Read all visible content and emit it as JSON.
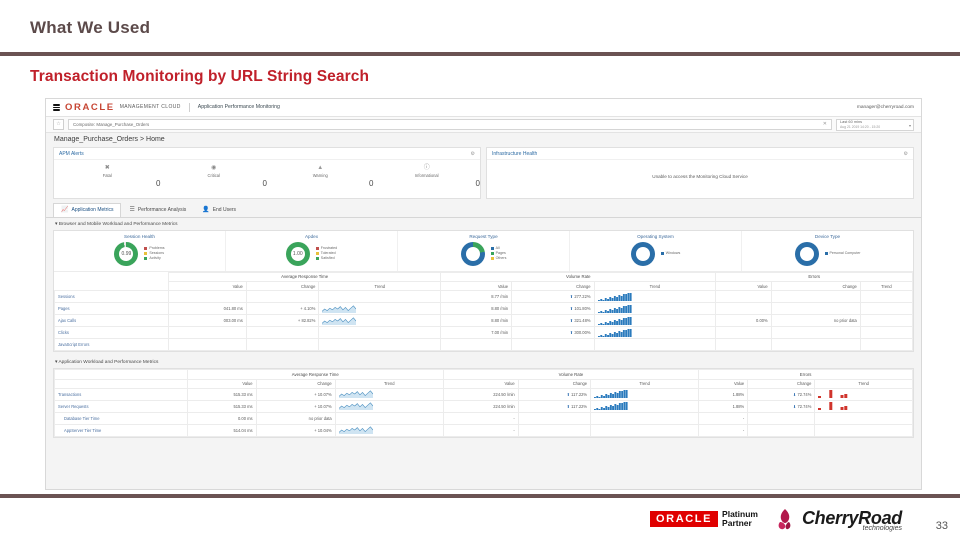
{
  "slide": {
    "title": "What We Used",
    "subtitle": "Transaction Monitoring by URL String Search",
    "page_number": "33",
    "rule_color": "#6b5353",
    "subtitle_color": "#c0202a"
  },
  "screenshot": {
    "topbar": {
      "menu_icon": "hamburger-icon",
      "brand": "ORACLE",
      "brand_suffix": "MANAGEMENT CLOUD",
      "app_name": "Application Performance Monitoring",
      "user": "manager@cherryroad.com"
    },
    "searchbar": {
      "favorite_icon": "star-icon",
      "value": "Composite: Manage_Purchase_Orders",
      "clear_icon": "close-icon",
      "time_selector": {
        "label": "Last 60 mins",
        "range": "Aug 21 2019 14:20 - 15:20",
        "chevron_icon": "chevron-down-icon"
      }
    },
    "breadcrumb": "Manage_Purchase_Orders > Home",
    "cards": [
      {
        "title": "APM Alerts",
        "gear_icon": "gear-icon",
        "alerts": [
          {
            "icon": "fatal-icon",
            "color": "#8a8a8a",
            "label": "Fatal",
            "count": "0"
          },
          {
            "icon": "critical-icon",
            "color": "#8a8a8a",
            "label": "Critical",
            "count": "0"
          },
          {
            "icon": "warning-icon",
            "color": "#9a9a9a",
            "label": "Warning",
            "count": "0"
          },
          {
            "icon": "info-icon",
            "color": "#8a8a8a",
            "label": "Informational",
            "count": "0"
          }
        ]
      },
      {
        "title": "Infrastructure Health",
        "gear_icon": "gear-icon",
        "message": "Unable to access the Monitoring Cloud Service"
      }
    ],
    "tabs": [
      {
        "label": "Application Metrics",
        "icon": "chart-icon",
        "selected": true
      },
      {
        "label": "Performance Analysis",
        "icon": "bars-icon",
        "selected": false
      },
      {
        "label": "End Users",
        "icon": "user-icon",
        "selected": false
      }
    ],
    "section_browser": {
      "heading": "Browser and Mobile Workload and Performance Metrics",
      "donuts": [
        {
          "title": "Session Health",
          "value": "0.99",
          "ring_color": "#3aa45b",
          "legend": [
            {
              "label": "Problems",
              "color": "#c0504d"
            },
            {
              "label": "Sessions",
              "color": "#e8c13b"
            },
            {
              "label": "Activity",
              "color": "#3aa45b"
            }
          ]
        },
        {
          "title": "Apdex",
          "value": "1.00",
          "ring_color": "#3aa45b",
          "legend": [
            {
              "label": "Frustrated",
              "color": "#c0504d"
            },
            {
              "label": "Tolerated",
              "color": "#e8c13b"
            },
            {
              "label": "Satisfied",
              "color": "#3aa45b"
            }
          ]
        },
        {
          "title": "Request Type",
          "value": "",
          "ring_color": "#2a6ea8",
          "legend": [
            {
              "label": "All",
              "color": "#2a6ea8"
            },
            {
              "label": "Pages",
              "color": "#3aa45b"
            },
            {
              "label": "Others",
              "color": "#e8c13b"
            }
          ]
        },
        {
          "title": "Operating System",
          "value": "",
          "ring_color": "#2a6ea8",
          "legend": [
            {
              "label": "Windows",
              "color": "#2a6ea8"
            }
          ]
        },
        {
          "title": "Device Type",
          "value": "",
          "ring_color": "#2a6ea8",
          "legend": [
            {
              "label": "Personal Computer",
              "color": "#2a6ea8"
            }
          ]
        }
      ],
      "table": {
        "group_headers": [
          "",
          "Average Response Time",
          "Volume Rate",
          "Errors"
        ],
        "sub_headers": [
          "",
          "Value",
          "Change",
          "Trend",
          "Value",
          "Change",
          "Trend",
          "Value",
          "Change",
          "Trend"
        ],
        "rows": [
          {
            "label": "Sessions",
            "art_value": "",
            "art_change": "",
            "art_trend": "none",
            "vol_value": "8.77 /min",
            "vol_change": "277.22%",
            "vol_dir": "up",
            "vol_trend": "bars",
            "err_value": "",
            "err_change": "",
            "err_trend": "none"
          },
          {
            "label": "Pages",
            "art_value": "041.80 ms",
            "art_change": "+ 4.10%",
            "art_trend": "line",
            "vol_value": "8.80 /min",
            "vol_change": "101.80%",
            "vol_dir": "up",
            "vol_trend": "bars",
            "err_value": "",
            "err_change": "",
            "err_trend": "none"
          },
          {
            "label": "Ajax Calls",
            "art_value": "003.00 ms",
            "art_change": "+ 82.82%",
            "art_trend": "line",
            "vol_value": "8.80 /min",
            "vol_change": "321.48%",
            "vol_dir": "up",
            "vol_trend": "bars",
            "err_value": "0.00%",
            "err_change": "no prior data",
            "err_trend": "none"
          },
          {
            "label": "Clicks",
            "art_value": "",
            "art_change": "",
            "art_trend": "none",
            "vol_value": "7.00 /min",
            "vol_change": "300.00%",
            "vol_dir": "up",
            "vol_trend": "bars",
            "err_value": "",
            "err_change": "",
            "err_trend": "none"
          },
          {
            "label": "JavaScript Errors",
            "art_value": "",
            "art_change": "",
            "art_trend": "none",
            "vol_value": "",
            "vol_change": "",
            "vol_dir": "",
            "vol_trend": "none",
            "err_value": "",
            "err_change": "",
            "err_trend": "none"
          }
        ]
      }
    },
    "section_app": {
      "heading": "Application Workload and Performance Metrics",
      "table": {
        "group_headers": [
          "",
          "Average Response Time",
          "Volume Rate",
          "Errors"
        ],
        "sub_headers": [
          "",
          "Value",
          "Change",
          "Trend",
          "Value",
          "Change",
          "Trend",
          "Value",
          "Change",
          "Trend"
        ],
        "rows": [
          {
            "label": "Transactions",
            "indent": false,
            "art_value": "515.33 ms",
            "art_change": "+ 10.07%",
            "art_trend": "line",
            "vol_value": "224.50 /min",
            "vol_change": "117.22%",
            "vol_dir": "up",
            "vol_trend": "bars",
            "err_value": "1.88%",
            "err_change": "72.74%",
            "err_dir": "down",
            "err_trend": "redbars"
          },
          {
            "label": "Server Requests",
            "indent": false,
            "art_value": "515.33 ms",
            "art_change": "+ 10.07%",
            "art_trend": "line",
            "vol_value": "224.50 /min",
            "vol_change": "117.22%",
            "vol_dir": "up",
            "vol_trend": "bars",
            "err_value": "1.88%",
            "err_change": "72.74%",
            "err_dir": "down",
            "err_trend": "redbars"
          },
          {
            "label": "Database Tier Time",
            "indent": true,
            "art_value": "0.00 ms",
            "art_change": "no prior data",
            "art_trend": "none",
            "vol_value": "-",
            "vol_change": "",
            "vol_dir": "",
            "vol_trend": "none",
            "err_value": "-",
            "err_change": "",
            "err_dir": "",
            "err_trend": "none"
          },
          {
            "label": "AppServer Tier Time",
            "indent": true,
            "art_value": "514.04 ms",
            "art_change": "+ 10.04%",
            "art_trend": "line",
            "vol_value": "-",
            "vol_change": "",
            "vol_dir": "",
            "vol_trend": "none",
            "err_value": "-",
            "err_change": "",
            "err_dir": "",
            "err_trend": "none"
          }
        ]
      }
    }
  },
  "footer": {
    "oracle_logo_text": "ORACLE",
    "oracle_partner_line1": "Platinum",
    "oracle_partner_line2": "Partner",
    "cherryroad_name": "CherryRoad",
    "cherryroad_sub": "technologies"
  }
}
